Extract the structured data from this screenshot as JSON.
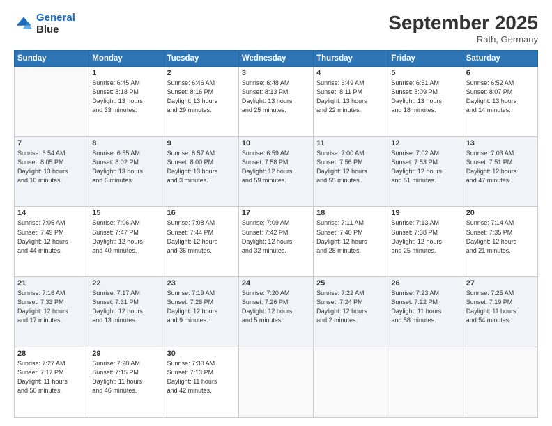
{
  "header": {
    "logo_line1": "General",
    "logo_line2": "Blue",
    "month": "September 2025",
    "location": "Rath, Germany"
  },
  "weekdays": [
    "Sunday",
    "Monday",
    "Tuesday",
    "Wednesday",
    "Thursday",
    "Friday",
    "Saturday"
  ],
  "weeks": [
    [
      {
        "day": "",
        "info": ""
      },
      {
        "day": "1",
        "info": "Sunrise: 6:45 AM\nSunset: 8:18 PM\nDaylight: 13 hours\nand 33 minutes."
      },
      {
        "day": "2",
        "info": "Sunrise: 6:46 AM\nSunset: 8:16 PM\nDaylight: 13 hours\nand 29 minutes."
      },
      {
        "day": "3",
        "info": "Sunrise: 6:48 AM\nSunset: 8:13 PM\nDaylight: 13 hours\nand 25 minutes."
      },
      {
        "day": "4",
        "info": "Sunrise: 6:49 AM\nSunset: 8:11 PM\nDaylight: 13 hours\nand 22 minutes."
      },
      {
        "day": "5",
        "info": "Sunrise: 6:51 AM\nSunset: 8:09 PM\nDaylight: 13 hours\nand 18 minutes."
      },
      {
        "day": "6",
        "info": "Sunrise: 6:52 AM\nSunset: 8:07 PM\nDaylight: 13 hours\nand 14 minutes."
      }
    ],
    [
      {
        "day": "7",
        "info": "Sunrise: 6:54 AM\nSunset: 8:05 PM\nDaylight: 13 hours\nand 10 minutes."
      },
      {
        "day": "8",
        "info": "Sunrise: 6:55 AM\nSunset: 8:02 PM\nDaylight: 13 hours\nand 6 minutes."
      },
      {
        "day": "9",
        "info": "Sunrise: 6:57 AM\nSunset: 8:00 PM\nDaylight: 13 hours\nand 3 minutes."
      },
      {
        "day": "10",
        "info": "Sunrise: 6:59 AM\nSunset: 7:58 PM\nDaylight: 12 hours\nand 59 minutes."
      },
      {
        "day": "11",
        "info": "Sunrise: 7:00 AM\nSunset: 7:56 PM\nDaylight: 12 hours\nand 55 minutes."
      },
      {
        "day": "12",
        "info": "Sunrise: 7:02 AM\nSunset: 7:53 PM\nDaylight: 12 hours\nand 51 minutes."
      },
      {
        "day": "13",
        "info": "Sunrise: 7:03 AM\nSunset: 7:51 PM\nDaylight: 12 hours\nand 47 minutes."
      }
    ],
    [
      {
        "day": "14",
        "info": "Sunrise: 7:05 AM\nSunset: 7:49 PM\nDaylight: 12 hours\nand 44 minutes."
      },
      {
        "day": "15",
        "info": "Sunrise: 7:06 AM\nSunset: 7:47 PM\nDaylight: 12 hours\nand 40 minutes."
      },
      {
        "day": "16",
        "info": "Sunrise: 7:08 AM\nSunset: 7:44 PM\nDaylight: 12 hours\nand 36 minutes."
      },
      {
        "day": "17",
        "info": "Sunrise: 7:09 AM\nSunset: 7:42 PM\nDaylight: 12 hours\nand 32 minutes."
      },
      {
        "day": "18",
        "info": "Sunrise: 7:11 AM\nSunset: 7:40 PM\nDaylight: 12 hours\nand 28 minutes."
      },
      {
        "day": "19",
        "info": "Sunrise: 7:13 AM\nSunset: 7:38 PM\nDaylight: 12 hours\nand 25 minutes."
      },
      {
        "day": "20",
        "info": "Sunrise: 7:14 AM\nSunset: 7:35 PM\nDaylight: 12 hours\nand 21 minutes."
      }
    ],
    [
      {
        "day": "21",
        "info": "Sunrise: 7:16 AM\nSunset: 7:33 PM\nDaylight: 12 hours\nand 17 minutes."
      },
      {
        "day": "22",
        "info": "Sunrise: 7:17 AM\nSunset: 7:31 PM\nDaylight: 12 hours\nand 13 minutes."
      },
      {
        "day": "23",
        "info": "Sunrise: 7:19 AM\nSunset: 7:28 PM\nDaylight: 12 hours\nand 9 minutes."
      },
      {
        "day": "24",
        "info": "Sunrise: 7:20 AM\nSunset: 7:26 PM\nDaylight: 12 hours\nand 5 minutes."
      },
      {
        "day": "25",
        "info": "Sunrise: 7:22 AM\nSunset: 7:24 PM\nDaylight: 12 hours\nand 2 minutes."
      },
      {
        "day": "26",
        "info": "Sunrise: 7:23 AM\nSunset: 7:22 PM\nDaylight: 11 hours\nand 58 minutes."
      },
      {
        "day": "27",
        "info": "Sunrise: 7:25 AM\nSunset: 7:19 PM\nDaylight: 11 hours\nand 54 minutes."
      }
    ],
    [
      {
        "day": "28",
        "info": "Sunrise: 7:27 AM\nSunset: 7:17 PM\nDaylight: 11 hours\nand 50 minutes."
      },
      {
        "day": "29",
        "info": "Sunrise: 7:28 AM\nSunset: 7:15 PM\nDaylight: 11 hours\nand 46 minutes."
      },
      {
        "day": "30",
        "info": "Sunrise: 7:30 AM\nSunset: 7:13 PM\nDaylight: 11 hours\nand 42 minutes."
      },
      {
        "day": "",
        "info": ""
      },
      {
        "day": "",
        "info": ""
      },
      {
        "day": "",
        "info": ""
      },
      {
        "day": "",
        "info": ""
      }
    ]
  ]
}
